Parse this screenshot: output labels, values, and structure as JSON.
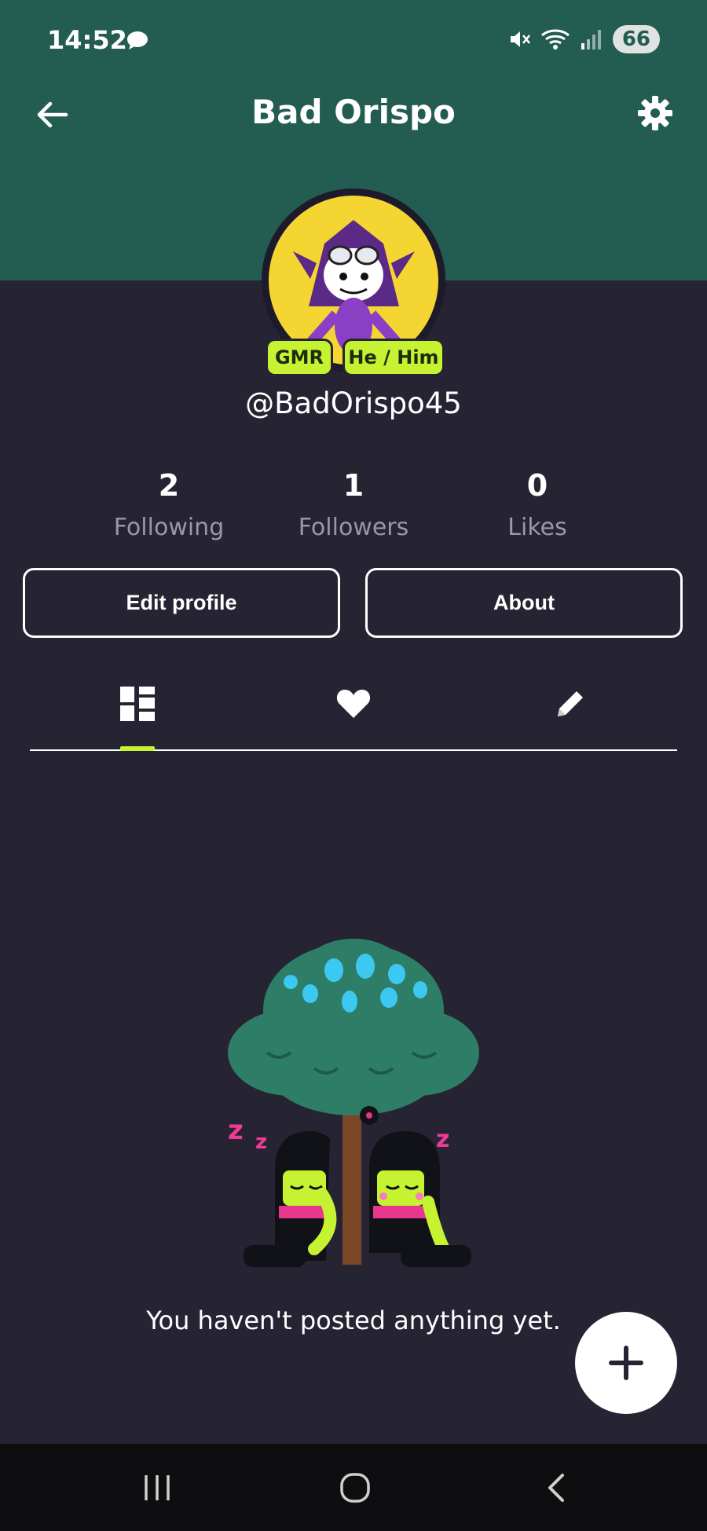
{
  "status_bar": {
    "time": "14:52",
    "battery": "66"
  },
  "header": {
    "title": "Bad Orispo"
  },
  "profile": {
    "handle": "@BadOrispo45",
    "badges": [
      "GMR",
      "He / Him"
    ]
  },
  "stats": [
    {
      "value": "2",
      "label": "Following"
    },
    {
      "value": "1",
      "label": "Followers"
    },
    {
      "value": "0",
      "label": "Likes"
    }
  ],
  "actions": {
    "edit": "Edit profile",
    "about": "About"
  },
  "tabs": [
    {
      "icon": "grid-icon",
      "active": true
    },
    {
      "icon": "heart-icon",
      "active": false
    },
    {
      "icon": "pencil-icon",
      "active": false
    }
  ],
  "empty_state": {
    "message": "You haven't posted anything yet."
  },
  "colors": {
    "header": "#235c50",
    "background": "#262432",
    "accent": "#c5f231"
  }
}
